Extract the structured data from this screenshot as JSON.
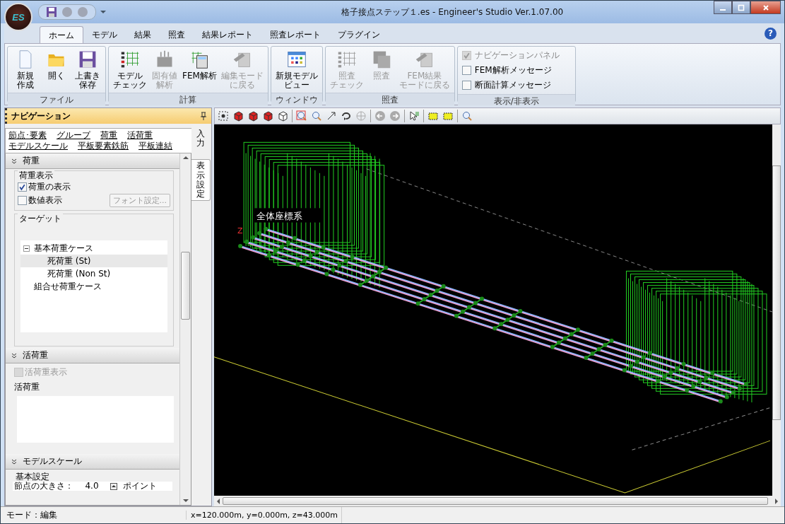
{
  "window": {
    "title": "格子接点ステップ１.es - Engineer's Studio Ver.1.07.00",
    "app_button": "ES"
  },
  "help_button": "?",
  "ribbon_tabs": [
    {
      "label": "ホーム",
      "selected": true
    },
    {
      "label": "モデル",
      "selected": false
    },
    {
      "label": "結果",
      "selected": false
    },
    {
      "label": "照査",
      "selected": false
    },
    {
      "label": "結果レポート",
      "selected": false
    },
    {
      "label": "照査レポート",
      "selected": false
    },
    {
      "label": "プラグイン",
      "selected": false
    }
  ],
  "ribbon_groups": [
    {
      "title": "ファイル",
      "items": [
        {
          "kind": "new",
          "lines": [
            "新規",
            "作成"
          ],
          "disabled": false
        },
        {
          "kind": "open",
          "lines": [
            "開く"
          ],
          "disabled": false
        },
        {
          "kind": "save",
          "lines": [
            "上書き",
            "保存"
          ],
          "disabled": false
        }
      ]
    },
    {
      "title": "計算",
      "items": [
        {
          "kind": "grid",
          "lines": [
            "モデル",
            "チェック"
          ],
          "disabled": false
        },
        {
          "kind": "eigen",
          "lines": [
            "固有値",
            "解析"
          ],
          "disabled": true
        },
        {
          "kind": "fem",
          "lines": [
            "FEM解析"
          ],
          "disabled": false
        },
        {
          "kind": "edit",
          "lines": [
            "編集モード",
            "に戻る"
          ],
          "disabled": true
        }
      ]
    },
    {
      "title": "ウィンドウ",
      "items": [
        {
          "kind": "view",
          "lines": [
            "新規モデル",
            "ビュー"
          ],
          "disabled": false
        }
      ]
    },
    {
      "title": "照査",
      "items": [
        {
          "kind": "grid",
          "lines": [
            "照査",
            "チェック"
          ],
          "disabled": true
        },
        {
          "kind": "check",
          "lines": [
            "照査"
          ],
          "disabled": true
        },
        {
          "kind": "edit",
          "lines": [
            "FEM結果",
            "モードに戻る"
          ],
          "disabled": true
        }
      ]
    }
  ],
  "display_group": {
    "title": "表示/非表示",
    "checkboxes": [
      {
        "label": "ナビゲーションパネル",
        "checked": true,
        "disabled": true
      },
      {
        "label": "FEM解析メッセージ",
        "checked": false,
        "disabled": false
      },
      {
        "label": "断面計算メッセージ",
        "checked": false,
        "disabled": false
      }
    ]
  },
  "navigation": {
    "title": "ナビゲーション",
    "links": [
      [
        "節点･要素",
        "グループ",
        "荷重",
        "活荷重"
      ],
      [
        "モデルスケール",
        "平板要素鉄筋",
        "平板連結"
      ]
    ],
    "side_tabs": [
      {
        "label": "入力",
        "selected": false
      },
      {
        "label": "表示設定",
        "selected": true
      }
    ],
    "load_section": {
      "title": "荷重",
      "display_group": "荷重表示",
      "checkboxes": [
        {
          "label": "荷重の表示",
          "checked": true
        },
        {
          "label": "数値表示",
          "checked": false
        }
      ],
      "font_button": {
        "label": "フォント設定...",
        "disabled": true
      },
      "target_group": "ターゲット",
      "tree": [
        {
          "label": "基本荷重ケース",
          "expanded": true,
          "selected": false,
          "children": [
            {
              "label": "死荷重 (St)",
              "selected": true
            },
            {
              "label": "死荷重 (Non St)",
              "selected": false
            }
          ]
        },
        {
          "label": "組合せ荷重ケース",
          "selected": false
        }
      ]
    },
    "live_load_section": {
      "title": "活荷重",
      "checkbox": {
        "label": "活荷重表示",
        "checked": false,
        "disabled": true
      },
      "list_label": "活荷重"
    },
    "model_scale_section": {
      "title": "モデルスケール",
      "group": "基本設定",
      "field_label": "節点の大きさ：",
      "value": "4.0",
      "unit": "ポイント"
    }
  },
  "viewport": {
    "axis_label": "全体座標系",
    "axis_letter": "Z"
  },
  "status_bar": {
    "mode": "モード：編集",
    "coordinates": "x=120.000m, y=0.000m, z=43.000m"
  }
}
